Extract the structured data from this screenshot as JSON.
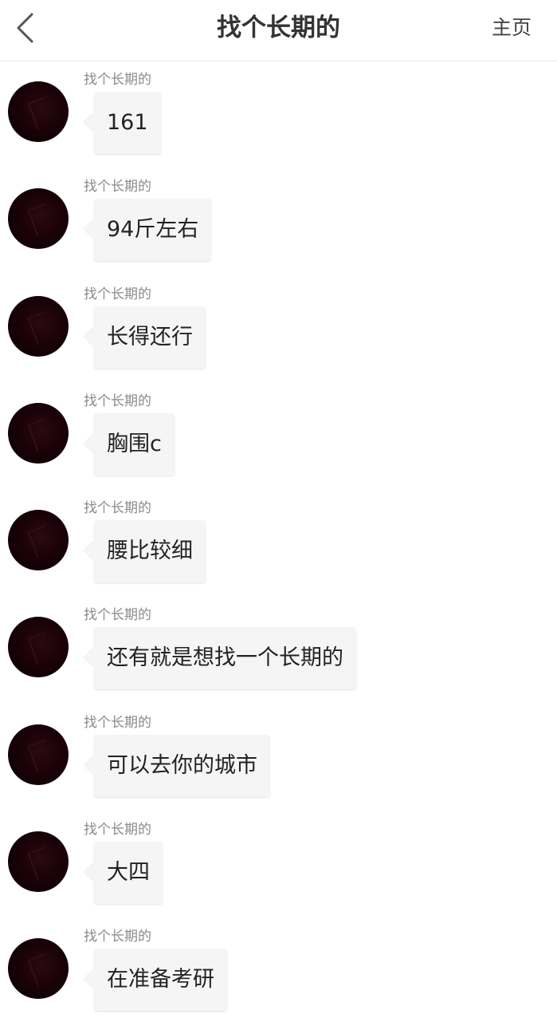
{
  "header": {
    "title": "找个长期的",
    "home_label": "主页",
    "back_icon": "chevron-left-icon"
  },
  "messages": [
    {
      "sender": "找个长期的",
      "text": "161"
    },
    {
      "sender": "找个长期的",
      "text": "94斤左右"
    },
    {
      "sender": "找个长期的",
      "text": "长得还行"
    },
    {
      "sender": "找个长期的",
      "text": "胸围c"
    },
    {
      "sender": "找个长期的",
      "text": "腰比较细"
    },
    {
      "sender": "找个长期的",
      "text": "还有就是想找一个长期的"
    },
    {
      "sender": "找个长期的",
      "text": "可以去你的城市"
    },
    {
      "sender": "找个长期的",
      "text": "大四"
    },
    {
      "sender": "找个长期的",
      "text": "在准备考研"
    }
  ],
  "colors": {
    "bubble_bg": "#f5f5f5",
    "sender_text": "#8a8a8a",
    "title_text": "#333333"
  }
}
